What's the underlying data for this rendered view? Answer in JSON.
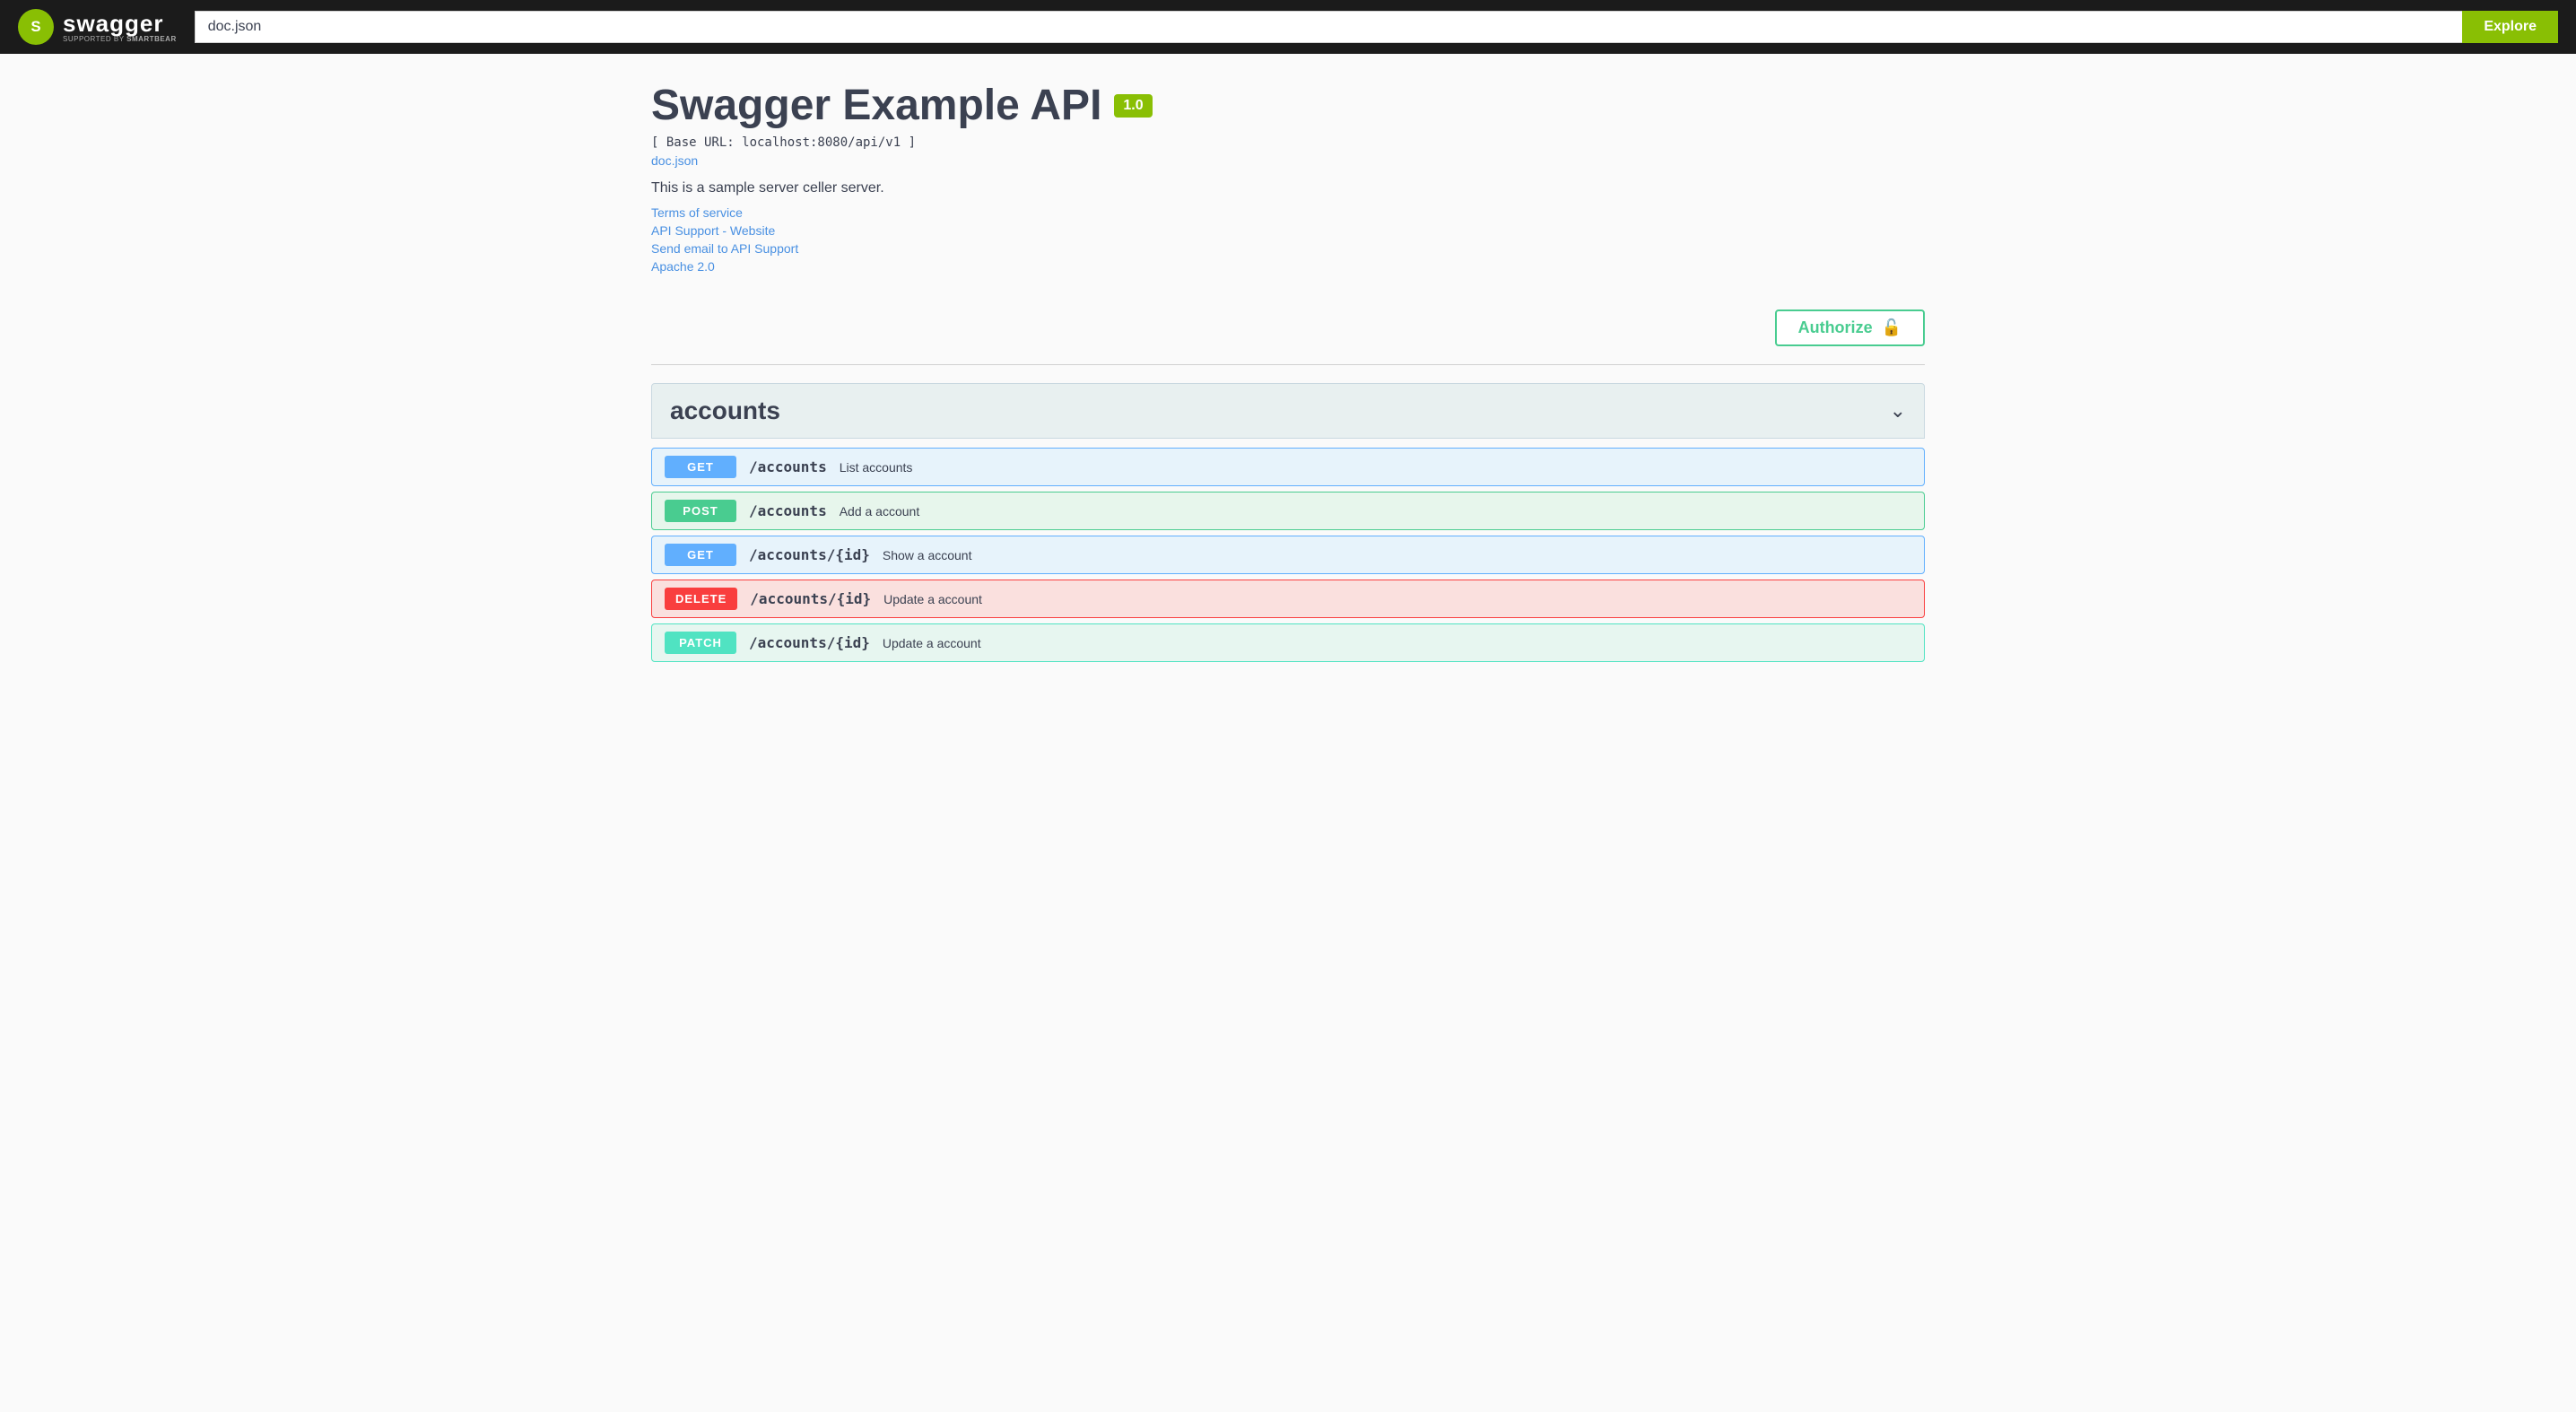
{
  "header": {
    "logo_letter": "S",
    "swagger_word": "swagger",
    "supported_by": "Supported by",
    "smartbear": "SMARTBEAR",
    "search_value": "doc.json",
    "explore_label": "Explore"
  },
  "api_info": {
    "title": "Swagger Example API",
    "version": "1.0",
    "base_url": "[ Base URL: localhost:8080/api/v1 ]",
    "doc_link_text": "doc.json",
    "description": "This is a sample server celler server.",
    "terms_of_service": "Terms of service",
    "api_support_website": "API Support - Website",
    "send_email": "Send email to API Support",
    "license": "Apache 2.0"
  },
  "authorize": {
    "button_label": "Authorize",
    "lock_icon": "🔓"
  },
  "sections": [
    {
      "name": "accounts",
      "title": "accounts",
      "endpoints": [
        {
          "method": "GET",
          "method_lower": "get",
          "path": "/accounts",
          "description": "List accounts"
        },
        {
          "method": "POST",
          "method_lower": "post",
          "path": "/accounts",
          "description": "Add a account"
        },
        {
          "method": "GET",
          "method_lower": "get",
          "path": "/accounts/{id}",
          "description": "Show a account"
        },
        {
          "method": "DELETE",
          "method_lower": "delete",
          "path": "/accounts/{id}",
          "description": "Update a account"
        },
        {
          "method": "PATCH",
          "method_lower": "patch",
          "path": "/accounts/{id}",
          "description": "Update a account"
        }
      ]
    }
  ]
}
